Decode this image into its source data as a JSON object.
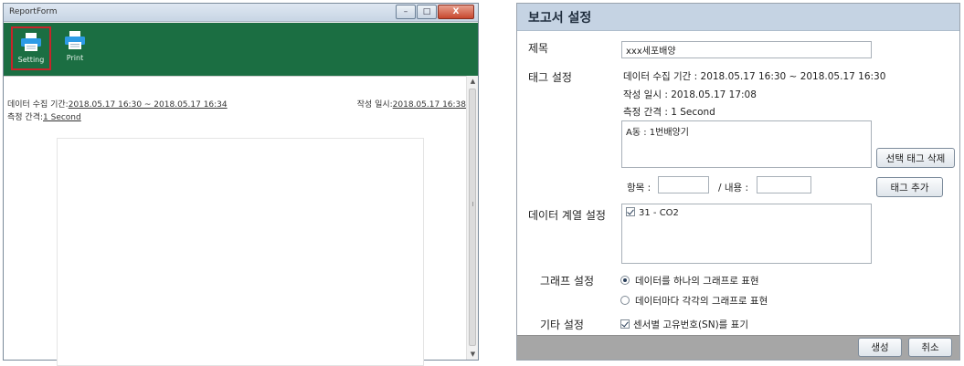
{
  "report_window": {
    "title": "ReportForm",
    "controls": {
      "minimize": "–",
      "maximize": "□",
      "close": "X"
    },
    "toolbar": {
      "setting_label": "Setting",
      "print_label": "Print",
      "setting_icon": "printer-icon",
      "print_icon": "printer-icon"
    },
    "meta": {
      "collect_label": "데이터 수집 기간:",
      "collect_value": "2018.05.17 16:30 ~ 2018.05.17 16:34",
      "interval_label": "측정 간격:",
      "interval_value": "1 Second",
      "written_label": "작성 일시:",
      "written_value": "2018.05.17 16:38"
    },
    "scroll": {
      "up": "▲",
      "down": "▼"
    }
  },
  "dialog": {
    "title": "보고서 설정",
    "title_field": {
      "label": "제목",
      "value": "xxx세포배양"
    },
    "tag_settings": {
      "label": "태그 설정",
      "collect_line": "데이터 수집 기간 : 2018.05.17 16:30 ~ 2018.05.17 16:30",
      "written_line": "작성 일시 : 2018.05.17 17:08",
      "interval_line": "측정 간격 : 1 Second",
      "tag_list": "A동 : 1번배양기",
      "delete_button": "선택 태그 삭제",
      "item_label": "항목 :",
      "content_label": "/ 내용 :",
      "item_value": "",
      "content_value": "",
      "add_button": "태그 추가"
    },
    "series_settings": {
      "label": "데이터 계열 설정",
      "items": [
        "31 - CO2"
      ]
    },
    "graph_settings": {
      "label": "그래프 설정",
      "option_single": "데이터를 하나의 그래프로 표현",
      "option_each": "데이터마다 각각의 그래프로 표현",
      "selected": "option_single"
    },
    "other_settings": {
      "label": "기타 설정",
      "sensor_sn": "센서별 고유번호(SN)를 표기"
    },
    "footer": {
      "create_button": "생성",
      "cancel_button": "취소"
    }
  },
  "colors": {
    "toolbar_green": "#1b6e42",
    "highlight_red": "#c8242a",
    "dialog_header": "#c5d3e3",
    "footer_gray": "#a6a6a6"
  }
}
